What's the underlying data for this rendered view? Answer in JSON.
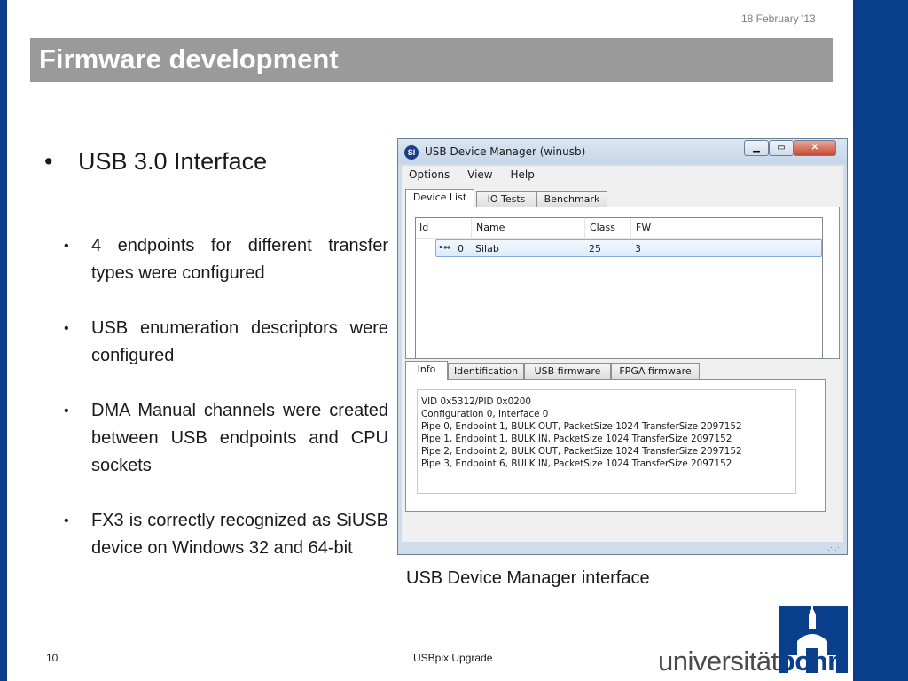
{
  "slide": {
    "date": "18 February '13",
    "title": "Firmware development",
    "main_bullet": "USB 3.0 Interface",
    "sub_bullets": [
      "4 endpoints for different transfer types were configured",
      "USB enumeration descriptors were configured",
      "DMA Manual channels were created between USB endpoints and CPU sockets",
      "FX3 is correctly recognized as SiUSB device on Windows 32 and 64-bit"
    ],
    "caption": "USB Device Manager interface",
    "page_number": "10",
    "footer_title": "USBpix Upgrade",
    "logo": {
      "part1": "universität",
      "part2": "bonn"
    },
    "colors": {
      "brand_blue": "#0a3f8c",
      "title_bar": "#9a9a9a"
    }
  },
  "window": {
    "app_icon_text": "SI",
    "title": "USB Device Manager (winusb)",
    "controls": {
      "minimize": "minimize-icon",
      "maximize": "maximize-icon",
      "close": "close-icon"
    },
    "menu": [
      "Options",
      "View",
      "Help"
    ],
    "tabs": [
      "Device List",
      "IO Tests",
      "Benchmark"
    ],
    "device_list": {
      "columns": [
        "Id",
        "Name",
        "Class",
        "FW"
      ],
      "rows": [
        {
          "icon": "usb-icon",
          "id": "0",
          "name": "Silab",
          "class": "25",
          "fw": "3"
        }
      ]
    },
    "info_tabs": [
      "Info",
      "Identification",
      "USB firmware",
      "FPGA firmware"
    ],
    "info_lines": [
      "VID 0x5312/PID 0x0200",
      "Configuration 0, Interface 0",
      "Pipe 0, Endpoint 1, BULK OUT, PacketSize 1024 TransferSize 2097152",
      "Pipe 1, Endpoint 1, BULK IN, PacketSize 1024 TransferSize 2097152",
      "Pipe 2, Endpoint 2, BULK OUT, PacketSize 1024 TransferSize 2097152",
      "Pipe 3, Endpoint 6, BULK IN, PacketSize 1024 TransferSize 2097152"
    ]
  }
}
